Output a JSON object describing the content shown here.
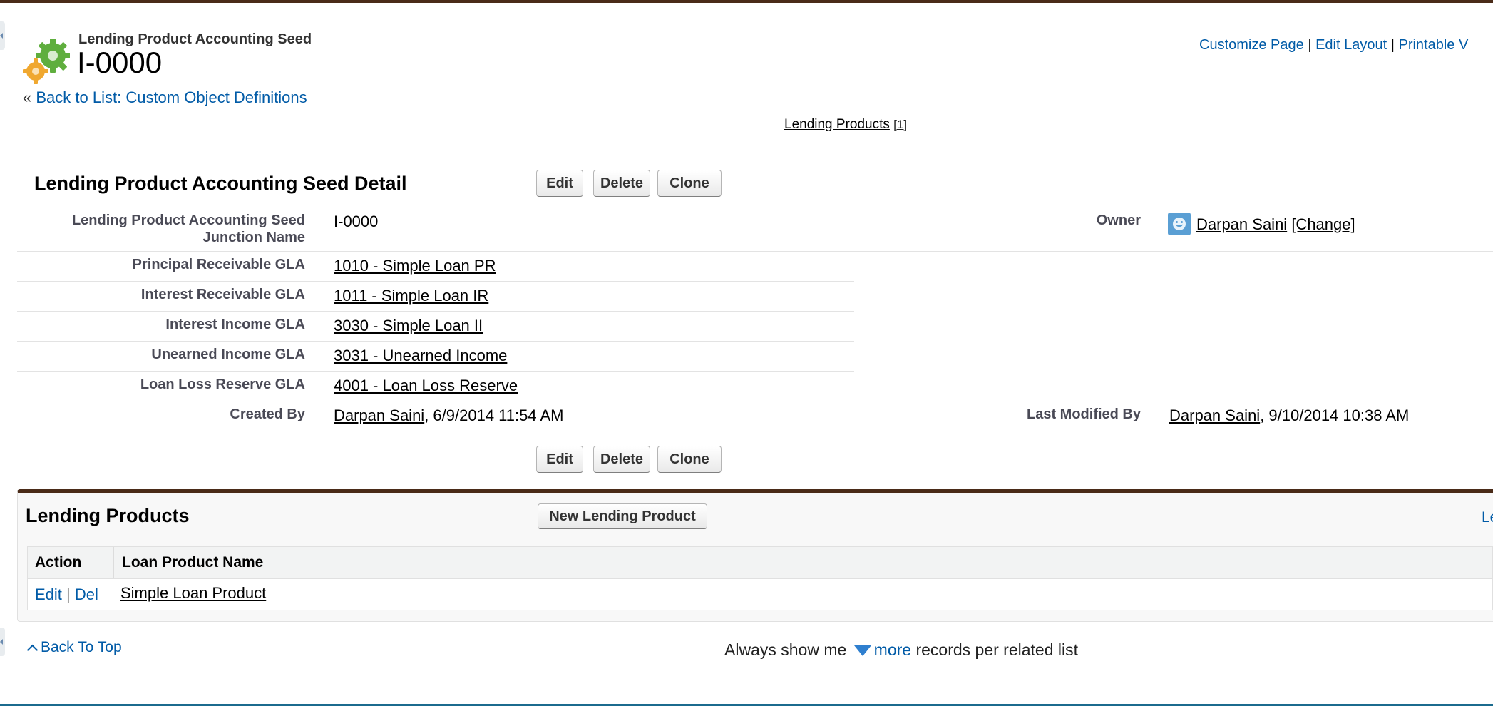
{
  "header": {
    "object_label": "Lending Product Accounting Seed",
    "record_name": "I-0000",
    "links": [
      "Customize Page",
      "Edit Layout",
      "Printable V"
    ],
    "back_link_prefix": "«",
    "back_link": "Back to List: Custom Object Definitions"
  },
  "related_hover": {
    "label": "Lending Products",
    "count": "[1]"
  },
  "detail": {
    "title": "Lending Product Accounting Seed Detail",
    "buttons": {
      "edit": "Edit",
      "delete": "Delete",
      "clone": "Clone"
    },
    "fields": {
      "junction_name_label_1": "Lending Product Accounting Seed",
      "junction_name_label_2": "Junction Name",
      "junction_name_value": "I-0000",
      "owner_label": "Owner",
      "owner_name": "Darpan Saini",
      "owner_change": "[Change]",
      "principal_label": "Principal Receivable GLA",
      "principal_value": "1010 - Simple Loan PR",
      "interest_recv_label": "Interest Receivable GLA",
      "interest_recv_value": "1011 - Simple Loan IR",
      "interest_income_label": "Interest Income GLA",
      "interest_income_value": "3030 - Simple Loan II",
      "unearned_label": "Unearned Income GLA",
      "unearned_value": "3031 - Unearned Income",
      "loss_reserve_label": "Loan Loss Reserve GLA",
      "loss_reserve_value": "4001 - Loan Loss Reserve",
      "created_by_label": "Created By",
      "created_by_name": "Darpan Saini",
      "created_by_date": ", 6/9/2014 11:54 AM",
      "modified_by_label": "Last Modified By",
      "modified_by_name": "Darpan Saini",
      "modified_by_date": ", 9/10/2014 10:38 AM"
    }
  },
  "related_list": {
    "title": "Lending Products",
    "new_button": "New Lending Product",
    "right_link": "Le",
    "columns": [
      "Action",
      "Loan Product Name"
    ],
    "rows": [
      {
        "edit": "Edit",
        "sep": "|",
        "del": "Del",
        "name": "Simple Loan Product"
      }
    ]
  },
  "footer": {
    "back_to_top": "Back To Top",
    "always_show": "Always show me",
    "more": "more",
    "records_text": "records per related list"
  }
}
